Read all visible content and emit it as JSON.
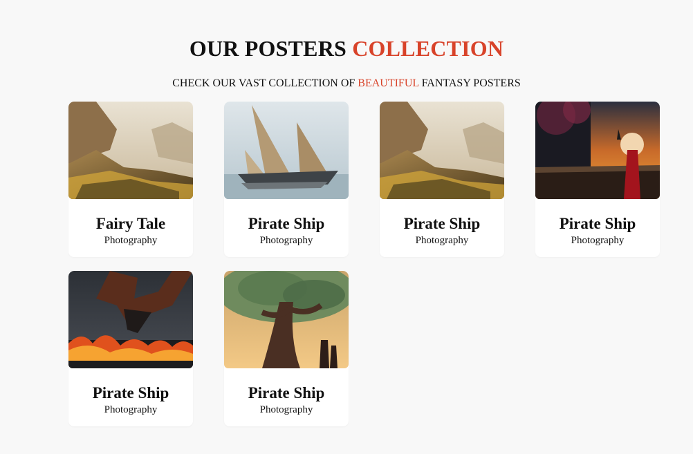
{
  "header": {
    "title_main": "OUR POSTERS",
    "title_accent": "COLLECTION",
    "subtitle_pre": "CHECK OUR VAST COLLECTION OF",
    "subtitle_accent": "BEAUTIFUL",
    "subtitle_post": "FANTASY POSTERS",
    "accent_color": "#d8432a"
  },
  "posters": [
    {
      "title": "Fairy Tale",
      "category": "Photography",
      "image": "mountain-valley-landscape"
    },
    {
      "title": "Pirate Ship",
      "category": "Photography",
      "image": "sailing-ship-in-fog"
    },
    {
      "title": "Pirate Ship",
      "category": "Photography",
      "image": "mountain-valley-landscape"
    },
    {
      "title": "Pirate Ship",
      "category": "Photography",
      "image": "woman-with-umbrella-at-sunset"
    },
    {
      "title": "Pirate Ship",
      "category": "Photography",
      "image": "dragon-over-burning-city"
    },
    {
      "title": "Pirate Ship",
      "category": "Photography",
      "image": "giant-tree-with-figures"
    }
  ]
}
